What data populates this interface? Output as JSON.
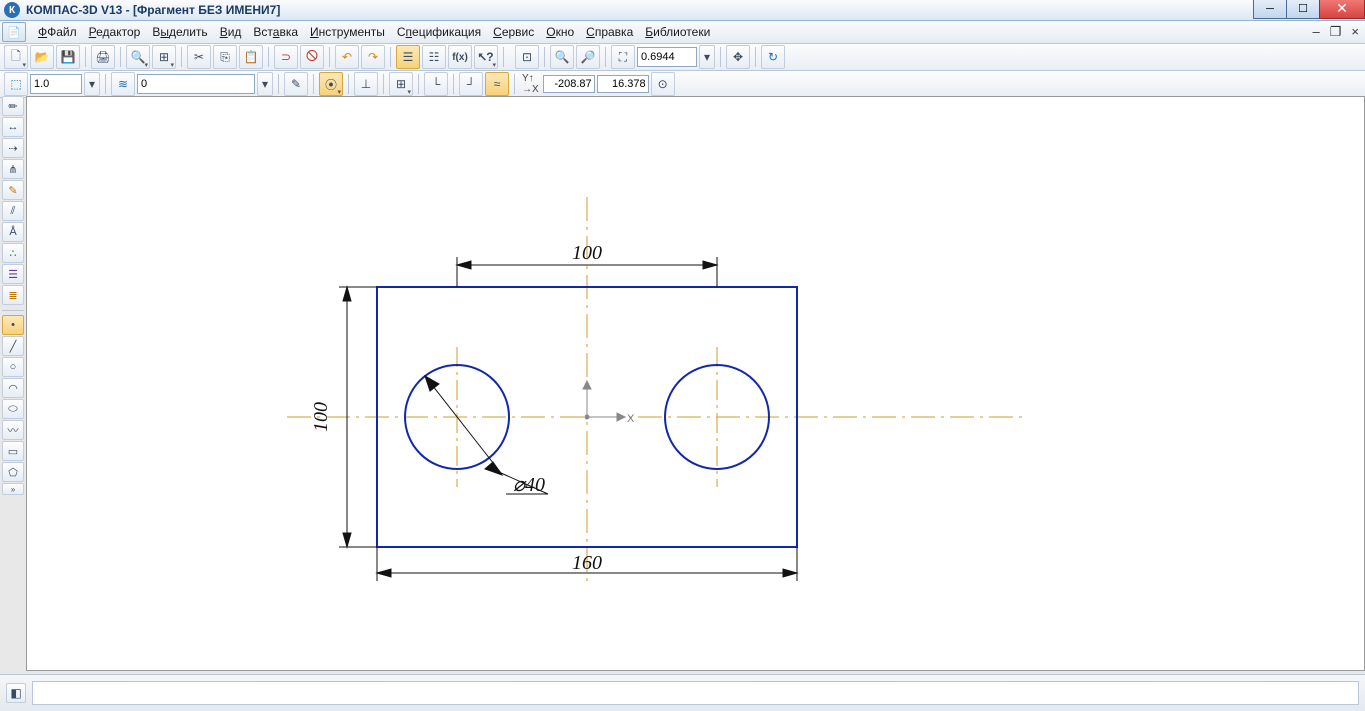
{
  "title": "КОМПАС-3D V13 - [Фрагмент БЕЗ ИМЕНИ7]",
  "menu": [
    "Файл",
    "Редактор",
    "Выделить",
    "Вид",
    "Вставка",
    "Инструменты",
    "Спецификация",
    "Сервис",
    "Окно",
    "Справка",
    "Библиотеки"
  ],
  "toolbar1": {
    "zoom_value": "0.6944"
  },
  "toolbar2": {
    "scale": "1.0",
    "layer": "0",
    "coord_x": "-208.87",
    "coord_y": "16.378"
  },
  "drawing": {
    "rect_w": "160",
    "rect_h": "100",
    "hole_spacing": "100",
    "hole_dia": "⌀40"
  }
}
